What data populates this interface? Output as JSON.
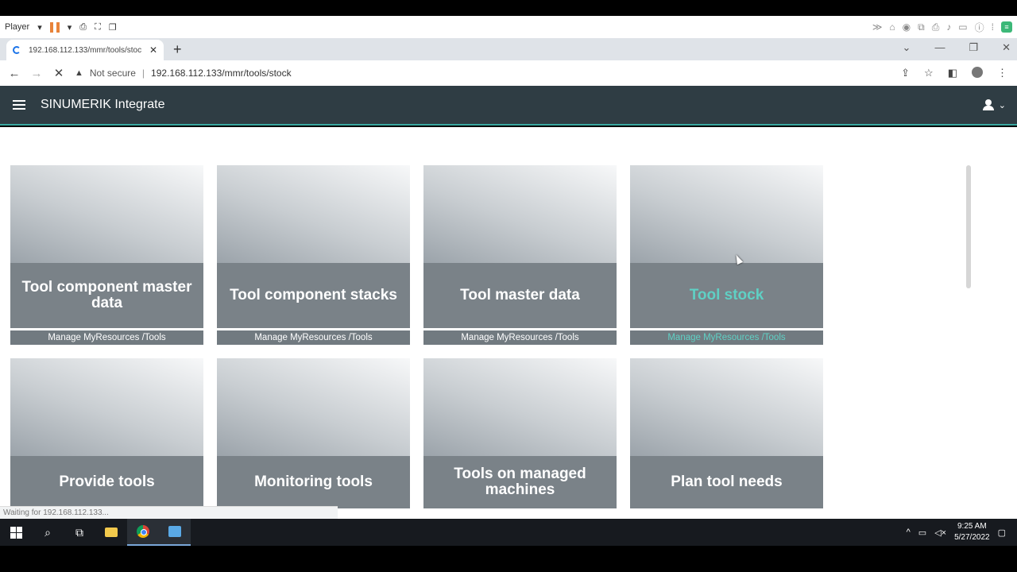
{
  "player": {
    "label": "Player"
  },
  "browser": {
    "tab_title": "192.168.112.133/mmr/tools/stoc",
    "security_label": "Not secure",
    "url": "192.168.112.133/mmr/tools/stock",
    "status_text": "Waiting for 192.168.112.133..."
  },
  "app": {
    "title": "SINUMERIK Integrate"
  },
  "tiles": [
    {
      "title": "Tool component master data",
      "footer": "Manage MyResources /Tools"
    },
    {
      "title": "Tool component stacks",
      "footer": "Manage MyResources /Tools"
    },
    {
      "title": "Tool master data",
      "footer": "Manage MyResources /Tools"
    },
    {
      "title": "Tool stock",
      "footer": "Manage MyResources /Tools"
    },
    {
      "title": "Provide tools"
    },
    {
      "title": "Monitoring tools"
    },
    {
      "title": "Tools on managed machines"
    },
    {
      "title": "Plan tool needs"
    }
  ],
  "taskbar": {
    "time": "9:25 AM",
    "date": "5/27/2022"
  },
  "colors": {
    "header": "#2f3d44",
    "accent": "#5fd0c4",
    "tile": "#7a8288"
  }
}
